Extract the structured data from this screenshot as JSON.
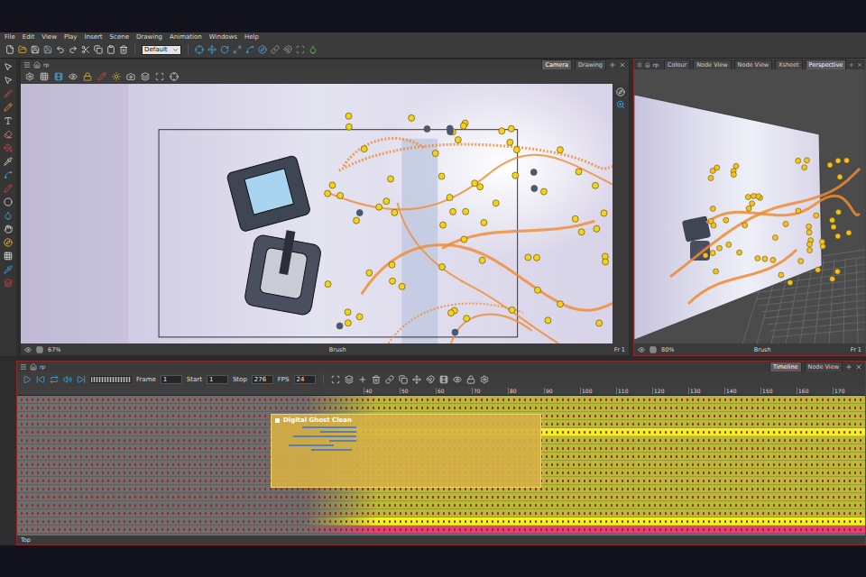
{
  "menu": [
    "File",
    "Edit",
    "View",
    "Play",
    "Insert",
    "Scene",
    "Drawing",
    "Animation",
    "Windows",
    "Help"
  ],
  "toolbar": {
    "workspace": "Default"
  },
  "camera_panel": {
    "title": "rp",
    "tabs": [
      {
        "label": "Camera",
        "selected": true
      },
      {
        "label": "Drawing",
        "selected": false
      }
    ],
    "status": {
      "zoom": "67%",
      "tool": "Brush",
      "frame": "Fr 1"
    }
  },
  "perspective_panel": {
    "title": "rp",
    "tabs": [
      {
        "label": "Colour",
        "selected": false
      },
      {
        "label": "Node View",
        "selected": false
      },
      {
        "label": "Node View",
        "selected": false
      },
      {
        "label": "Xsheet",
        "selected": false
      },
      {
        "label": "Perspective",
        "selected": true
      }
    ],
    "status": {
      "zoom": "80%",
      "tool": "Brush",
      "frame": "Fr 1"
    }
  },
  "timeline": {
    "title": "rp",
    "tabs": [
      {
        "label": "Timeline",
        "selected": true
      },
      {
        "label": "Node View",
        "selected": false
      }
    ],
    "fields": [
      {
        "label": "Frame",
        "value": "1"
      },
      {
        "label": "Start",
        "value": "1"
      },
      {
        "label": "Stop",
        "value": "276"
      },
      {
        "label": "FPS",
        "value": "24"
      }
    ],
    "ruler": [
      "40",
      "50",
      "60",
      "70",
      "80",
      "90",
      "100",
      "110",
      "120",
      "130",
      "140",
      "150",
      "160",
      "170"
    ],
    "group": "Digital Ghost Clean",
    "tracks": [
      {
        "kind": "normal"
      },
      {
        "kind": "normal"
      },
      {
        "kind": "normal"
      },
      {
        "kind": "normal"
      },
      {
        "kind": "highlight"
      },
      {
        "kind": "normal"
      },
      {
        "kind": "normal"
      },
      {
        "kind": "normal"
      },
      {
        "kind": "normal"
      },
      {
        "kind": "normal"
      },
      {
        "kind": "normal"
      },
      {
        "kind": "normal"
      },
      {
        "kind": "normal"
      },
      {
        "kind": "normal"
      },
      {
        "kind": "normal"
      },
      {
        "kind": "highlight"
      },
      {
        "kind": "pink"
      }
    ],
    "footer": "Top"
  }
}
